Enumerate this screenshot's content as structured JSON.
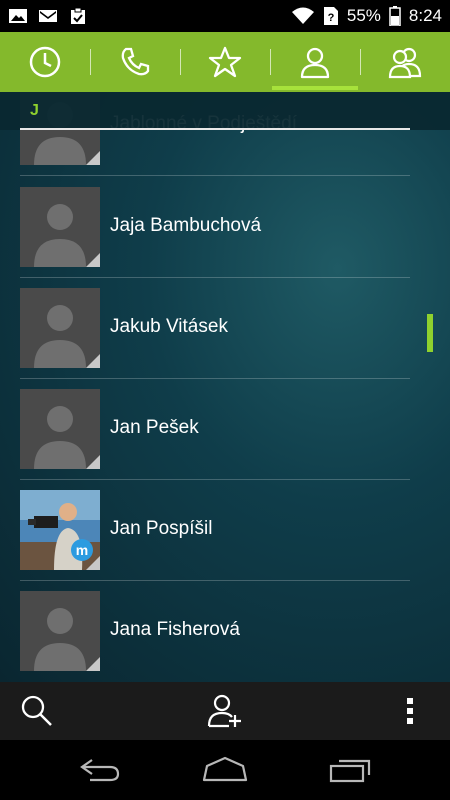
{
  "status_bar": {
    "battery_percent": "55%",
    "time": "8:24",
    "icons": [
      "image-icon",
      "gmail-icon",
      "clipboard-icon",
      "wifi-icon",
      "sim-unknown-icon",
      "battery-icon"
    ]
  },
  "tabs": [
    {
      "name": "recent-calls",
      "icon": "clock-icon",
      "active": false
    },
    {
      "name": "dialer",
      "icon": "phone-icon",
      "active": false
    },
    {
      "name": "favorites",
      "icon": "star-icon",
      "active": false
    },
    {
      "name": "contacts",
      "icon": "person-icon",
      "active": true
    },
    {
      "name": "groups",
      "icon": "group-icon",
      "active": false
    }
  ],
  "section": {
    "letter": "J"
  },
  "contacts": [
    {
      "name": "Jablonné v Podještědí",
      "photo": false
    },
    {
      "name": "Jaja Bambuchová",
      "photo": false
    },
    {
      "name": "Jakub Vitásek",
      "photo": false
    },
    {
      "name": "Jan Pešek",
      "photo": false
    },
    {
      "name": "Jan Pospíšil",
      "photo": true
    },
    {
      "name": "Jana Fisherová",
      "photo": false
    }
  ],
  "actions": [
    "search-icon",
    "add-contact-icon",
    "overflow-menu-icon"
  ],
  "nav": [
    "back-icon",
    "home-icon",
    "recent-apps-icon"
  ],
  "colors": {
    "accent": "#84b92c",
    "accent_light": "#a7e23b",
    "section_letter": "#8fd12e"
  }
}
